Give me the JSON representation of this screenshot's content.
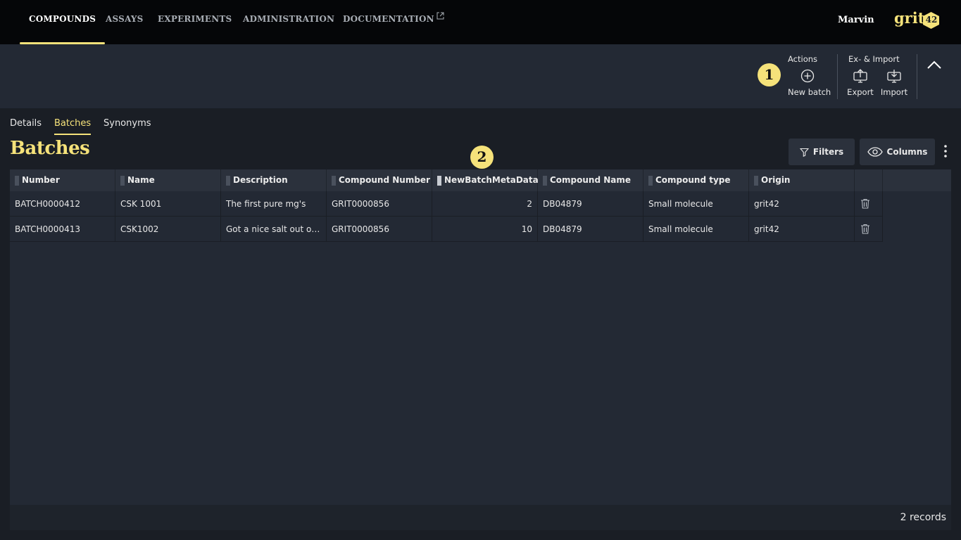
{
  "nav": {
    "items": [
      {
        "label": "COMPOUNDS"
      },
      {
        "label": "ASSAYS"
      },
      {
        "label": "EXPERIMENTS"
      },
      {
        "label": "ADMINISTRATION"
      },
      {
        "label": "DOCUMENTATION"
      }
    ],
    "active": "COMPOUNDS",
    "user": "Marvin",
    "logo_text": "grit",
    "logo_number": "42"
  },
  "toolbar": {
    "actions_title": "Actions",
    "new_batch_label": "New batch",
    "ex_import_title": "Ex- & Import",
    "export_label": "Export",
    "import_label": "Import"
  },
  "annotations": {
    "badge1": "1",
    "badge2": "2"
  },
  "tabs": [
    {
      "label": "Details"
    },
    {
      "label": "Batches"
    },
    {
      "label": "Synonyms"
    }
  ],
  "active_tab": "Batches",
  "page": {
    "title": "Batches",
    "filters_label": "Filters",
    "columns_label": "Columns"
  },
  "table": {
    "columns": [
      "Number",
      "Name",
      "Description",
      "Compound Number",
      "NewBatchMetaData",
      "Compound Name",
      "Compound type",
      "Origin"
    ],
    "rows": [
      [
        "BATCH0000412",
        "CSK 1001",
        "The first pure mg's",
        "GRIT0000856",
        "2",
        "DB04879",
        "Small molecule",
        "grit42"
      ],
      [
        "BATCH0000413",
        "CSK1002",
        "Got a nice salt out of …",
        "GRIT0000856",
        "10",
        "DB04879",
        "Small molecule",
        "grit42"
      ]
    ],
    "records": "2 records"
  },
  "colors": {
    "accent": "#f5e27a",
    "nav_bg": "#050608",
    "panel_bg": "#232934"
  },
  "icons": [
    "external-link-icon",
    "plus-circle-icon",
    "export-icon",
    "import-icon",
    "chevron-up-icon",
    "filter-icon",
    "eye-icon",
    "kebab-icon",
    "trash-icon"
  ]
}
